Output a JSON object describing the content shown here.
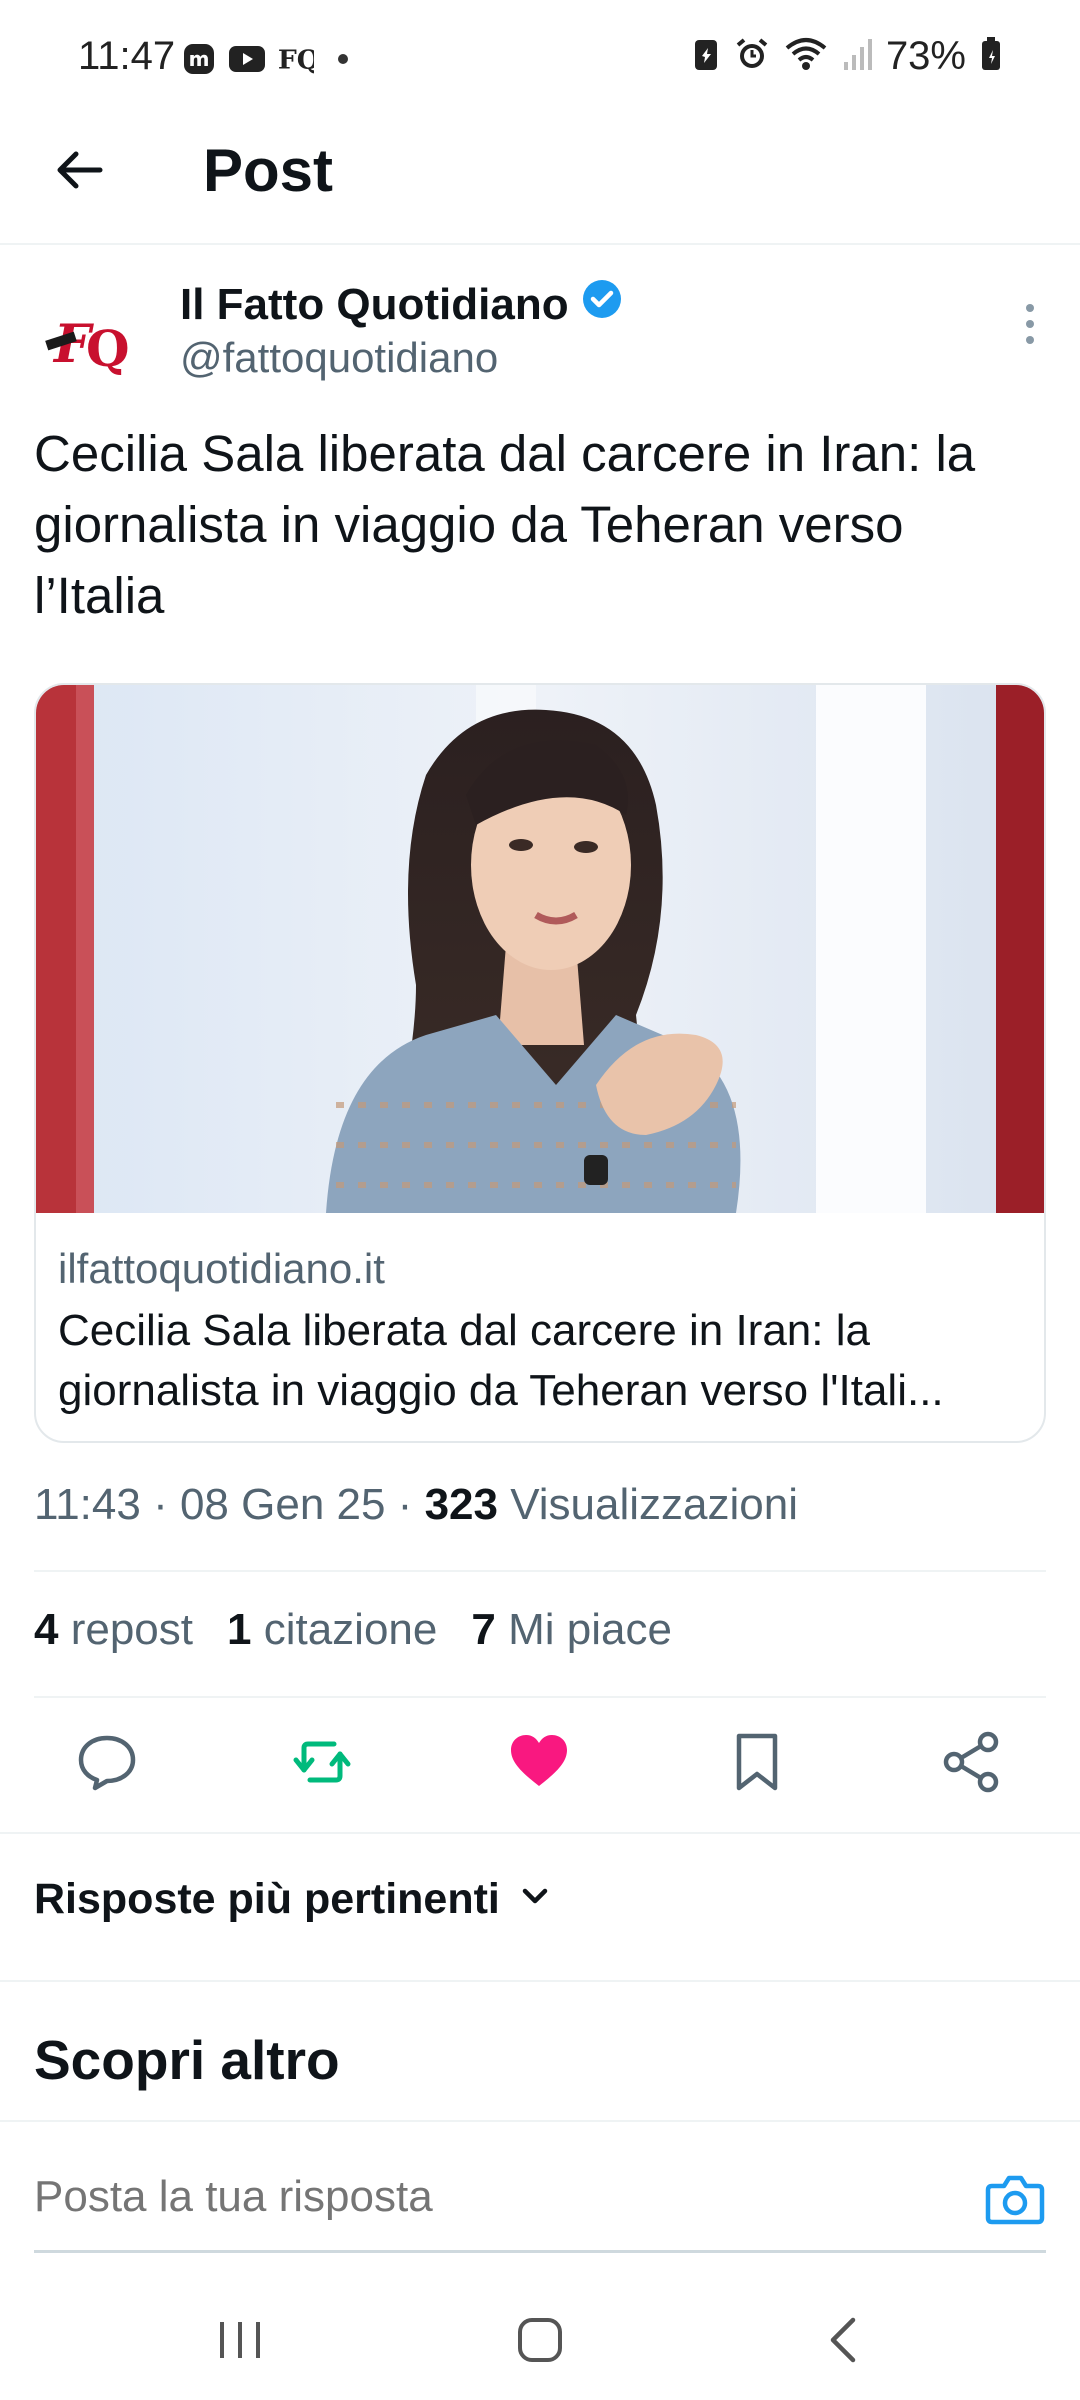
{
  "status_bar": {
    "time": "11:47",
    "battery": "73%",
    "left_icons": [
      "mastodon-icon",
      "youtube-icon",
      "fq-app-icon",
      "dot-icon"
    ],
    "right_icons": [
      "battery-saver-icon",
      "alarm-icon",
      "wifi-icon",
      "signal-icon",
      "battery-icon"
    ]
  },
  "header": {
    "title": "Post",
    "back_icon": "arrow-left-icon"
  },
  "post": {
    "author_name": "Il Fatto Quotidiano",
    "author_handle": "@fattoquotidiano",
    "verified": true,
    "text": "Cecilia Sala liberata dal carcere in Iran: la giornalista in viaggio da Teheran verso l’Italia",
    "card": {
      "domain": "ilfattoquotidiano.it",
      "title": "Cecilia Sala liberata dal carcere in Iran: la giornalista in viaggio da Teheran verso l'Itali..."
    },
    "meta": {
      "time": "11:43",
      "sep1": " · ",
      "date": "08 Gen 25",
      "sep2": " · ",
      "views_count": "323",
      "views_label": " Visualizzazioni"
    },
    "stats": {
      "reposts_count": "4",
      "reposts_label": " repost",
      "quotes_count": "1",
      "quotes_label": " citazione",
      "likes_count": "7",
      "likes_label": " Mi piace"
    }
  },
  "actions": [
    "reply-icon",
    "repost-icon",
    "like-icon",
    "bookmark-icon",
    "share-icon"
  ],
  "colors": {
    "accent": "#1d9bf0",
    "repost_green": "#00ba7c",
    "like_pink": "#f91880",
    "text_primary": "#0f1419",
    "text_secondary": "#536471"
  },
  "replies": {
    "sort_label": "Risposte più pertinenti",
    "discover_label": "Scopri altro"
  },
  "composer": {
    "placeholder": "Posta la tua risposta"
  },
  "navbar": {
    "buttons": [
      "recents-icon",
      "home-icon",
      "back-icon"
    ]
  }
}
